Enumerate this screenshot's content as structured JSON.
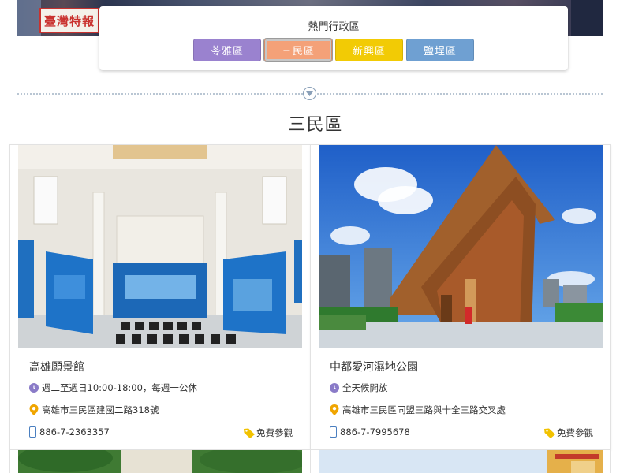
{
  "banner": {
    "sign_text": "臺灣特報"
  },
  "district_panel": {
    "title": "熱門行政區",
    "districts": [
      {
        "label": "苓雅區",
        "color": "#9a82cf",
        "active": false
      },
      {
        "label": "三民區",
        "color": "#f4a178",
        "active": true
      },
      {
        "label": "新興區",
        "color": "#f2cb05",
        "active": false
      },
      {
        "label": "鹽埕區",
        "color": "#6fa0d2",
        "active": false
      }
    ]
  },
  "section": {
    "title": "三民區"
  },
  "cards": [
    {
      "name": "高雄願景館",
      "hours": "週二至週日10:00-18:00，每週一公休",
      "address": "高雄市三民區建國二路318號",
      "phone": "886-7-2363357",
      "fee": "免費參觀"
    },
    {
      "name": "中都愛河濕地公園",
      "hours": "全天候開放",
      "address": "高雄市三民區同盟三路與十全三路交叉處",
      "phone": "886-7-7995678",
      "fee": "免費參觀"
    }
  ],
  "icons": {
    "clock": "clock-icon",
    "pin": "map-pin-icon",
    "phone": "phone-icon",
    "tag": "tag-icon",
    "divider": "chevron-down-circle-icon"
  },
  "colors": {
    "clock": "#8a7bc8",
    "pin": "#f0a500",
    "phone": "#4a7fc0",
    "tag": "#f2c200"
  }
}
